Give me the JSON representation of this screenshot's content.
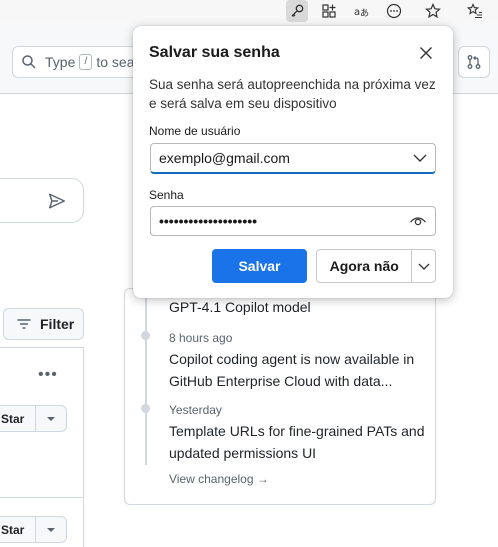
{
  "browser": {
    "icons": [
      "key-icon",
      "extensions-icon",
      "translate-icon",
      "more-icon",
      "favorite-star-icon",
      "favorites-list-icon"
    ]
  },
  "header": {
    "search_prefix": "Type",
    "search_key": "/",
    "search_suffix": "to sea"
  },
  "left": {
    "filter_label": "Filter",
    "more_label": "•••",
    "star_label": "Star"
  },
  "changelog": {
    "first_title": "GPT-4.1 Copilot model",
    "items": [
      {
        "time": "8 hours ago",
        "title": "Copilot coding agent is now available in GitHub Enterprise Cloud with data..."
      },
      {
        "time": "Yesterday",
        "title": "Template URLs for fine-grained PATs and updated permissions UI"
      }
    ],
    "view_label": "View changelog →"
  },
  "popup": {
    "title": "Salvar sua senha",
    "description": "Sua senha será autopreenchida na próxima vez e será salva em seu dispositivo",
    "username_label": "Nome de usuário",
    "username_value": "exemplo@gmail.com",
    "password_label": "Senha",
    "password_value": "••••••••••••••••••••",
    "save_label": "Salvar",
    "later_label": "Agora não"
  },
  "colors": {
    "primary": "#1a73e8",
    "focus": "#0f6cbd",
    "border": "#d0d7de"
  }
}
